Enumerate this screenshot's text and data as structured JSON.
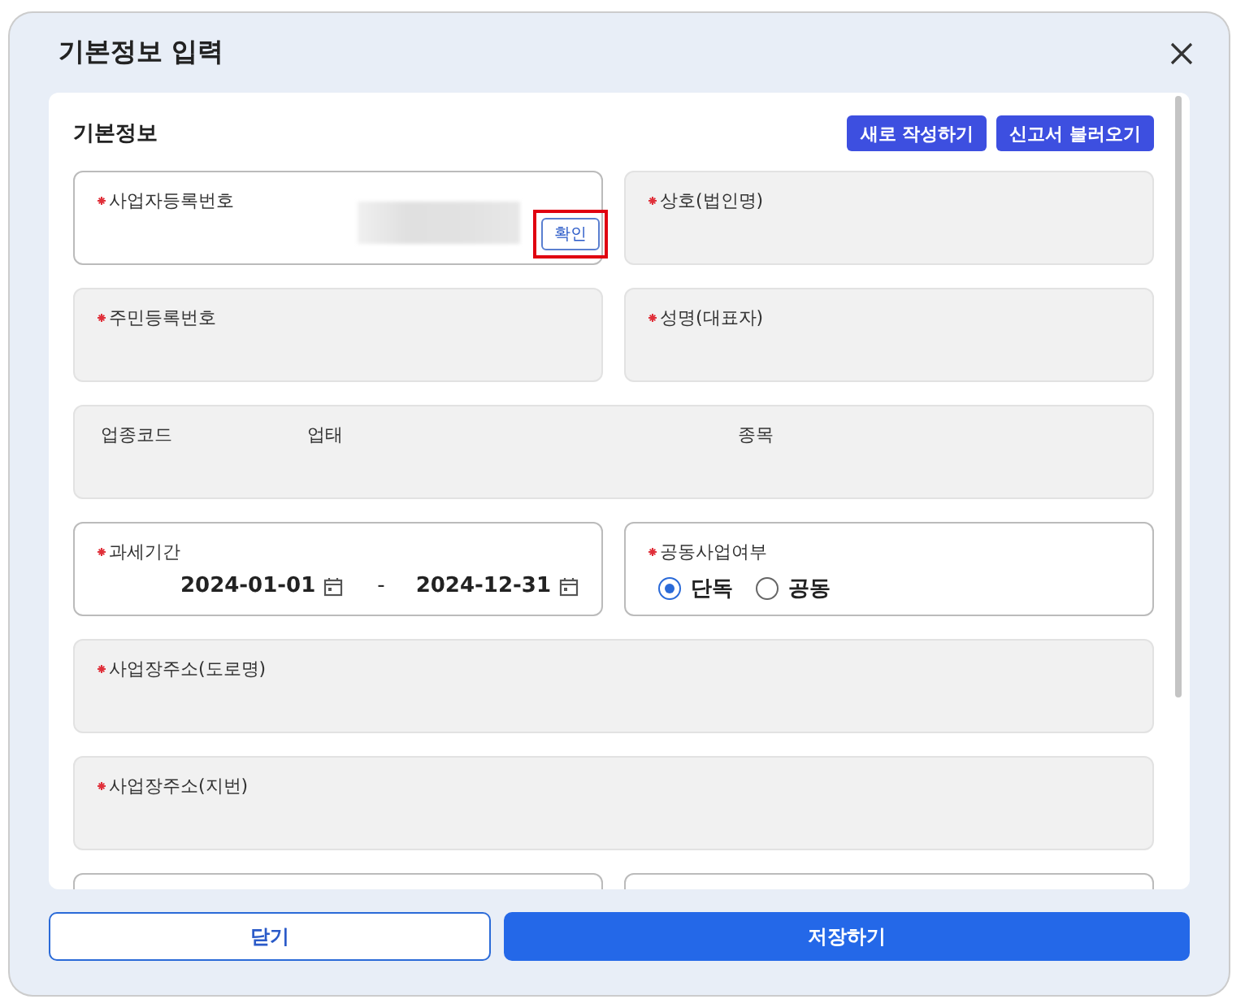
{
  "dialog": {
    "title": "기본정보 입력"
  },
  "section": {
    "title": "기본정보",
    "actions": [
      "새로 작성하기",
      "신고서 불러오기"
    ]
  },
  "rows": [
    [
      {
        "kind": "business_number",
        "label": "사업자등록번호",
        "required": true,
        "disabled": false,
        "value_masked": true,
        "button": {
          "label": "확인",
          "highlighted": true
        }
      },
      {
        "kind": "text",
        "label": "상호(법인명)",
        "required": true,
        "disabled": true
      }
    ],
    [
      {
        "kind": "text",
        "label": "주민등록번호",
        "required": true,
        "disabled": true
      },
      {
        "kind": "text",
        "label": "성명(대표자)",
        "required": true,
        "disabled": true
      }
    ],
    [
      {
        "kind": "columns",
        "labels": [
          "업종코드",
          "업태",
          "종목"
        ],
        "disabled": true
      }
    ],
    [
      {
        "kind": "date_range",
        "label": "과세기간",
        "required": true,
        "disabled": false,
        "start": "2024-01-01",
        "separator": "-",
        "end": "2024-12-31"
      },
      {
        "kind": "radio",
        "label": "공동사업여부",
        "required": true,
        "disabled": false,
        "options": [
          {
            "label": "단독",
            "selected": true
          },
          {
            "label": "공동",
            "selected": false
          }
        ]
      }
    ],
    [
      {
        "kind": "text",
        "label": "사업장주소(도로명)",
        "required": true,
        "disabled": true
      }
    ],
    [
      {
        "kind": "text",
        "label": "사업장주소(지번)",
        "required": true,
        "disabled": true
      }
    ],
    [
      {
        "kind": "text",
        "disabled": false
      },
      {
        "kind": "text",
        "disabled": false
      }
    ]
  ],
  "footer": {
    "buttons": [
      {
        "label": "닫기",
        "kind": "secondary"
      },
      {
        "label": "저장하기",
        "kind": "primary"
      }
    ]
  }
}
